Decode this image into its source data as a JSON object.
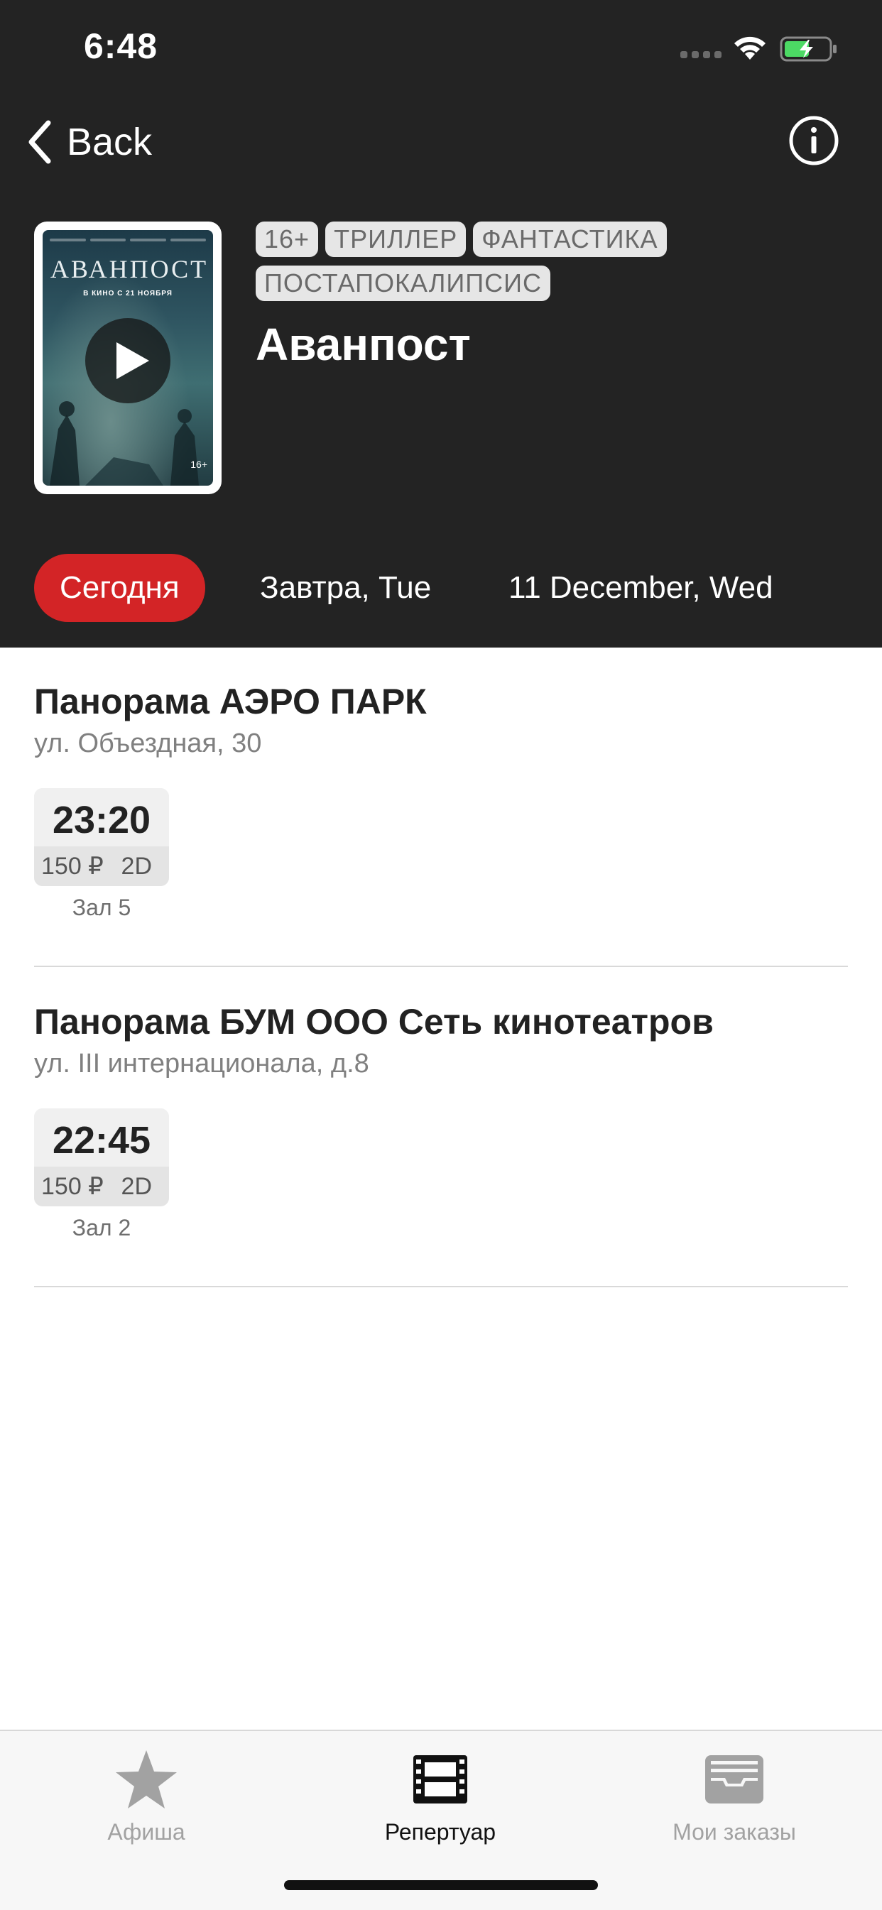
{
  "status_bar": {
    "time": "6:48",
    "icons": [
      "signal-dots-icon",
      "wifi-icon",
      "battery-charging-icon"
    ]
  },
  "nav": {
    "back_label": "Back",
    "info_icon": "info-circle-icon"
  },
  "movie": {
    "title": "Аванпост",
    "tags": [
      "16+",
      "ТРИЛЛЕР",
      "ФАНТАСТИКА",
      "ПОСТАПОКАЛИПСИС"
    ],
    "poster": {
      "title": "АВАНПОСТ",
      "subtitle": "В КИНО С 21 НОЯБРЯ",
      "age": "16+"
    }
  },
  "date_tabs": [
    {
      "label": "Сегодня",
      "active": true
    },
    {
      "label": "Завтра, Tue",
      "active": false
    },
    {
      "label": "11 December, Wed",
      "active": false
    }
  ],
  "cinemas": [
    {
      "name": "Панорама АЭРО ПАРК",
      "address": "ул. Объездная, 30",
      "sessions": [
        {
          "time": "23:20",
          "price": "150 ₽",
          "format": "2D",
          "hall": "Зал 5"
        }
      ]
    },
    {
      "name": "Панорама БУМ ООО Сеть кинотеатров",
      "address": "ул. III интернационала, д.8",
      "sessions": [
        {
          "time": "22:45",
          "price": "150 ₽",
          "format": "2D",
          "hall": "Зал 2"
        }
      ]
    }
  ],
  "tab_bar": {
    "items": [
      {
        "label": "Афиша",
        "icon": "star-icon",
        "active": false
      },
      {
        "label": "Репертуар",
        "icon": "film-strip-icon",
        "active": true
      },
      {
        "label": "Мои заказы",
        "icon": "tray-icon",
        "active": false
      }
    ]
  },
  "colors": {
    "header_bg": "#232323",
    "accent": "#d32426",
    "tag_bg": "#e6e6e6",
    "inactive_tab": "#a2a2a2"
  }
}
